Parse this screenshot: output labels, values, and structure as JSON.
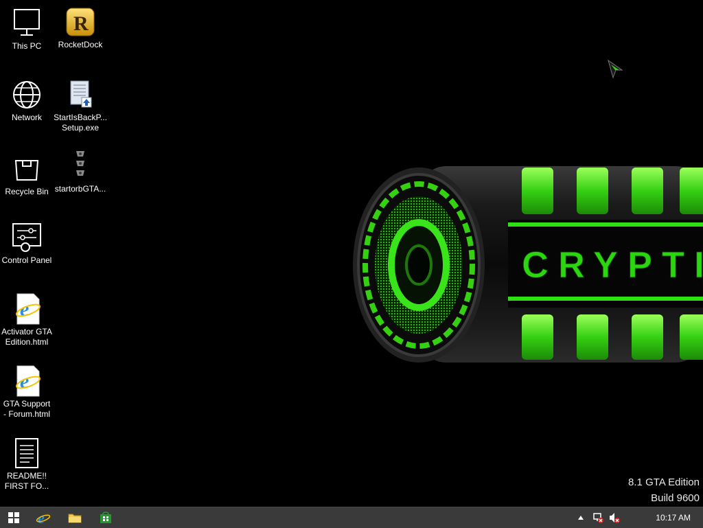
{
  "desktop": {
    "icons": [
      {
        "label": "This PC",
        "icon": "this-pc-icon"
      },
      {
        "label": "RocketDock",
        "icon": "rocketdock-icon"
      },
      {
        "label": "Network",
        "icon": "network-icon"
      },
      {
        "label": "StartIsBackP...\nSetup.exe",
        "icon": "installer-icon"
      },
      {
        "label": "Recycle Bin",
        "icon": "recycle-bin-icon"
      },
      {
        "label": "startorbGTA...",
        "icon": "start-orb-icon"
      },
      {
        "label": "Control Panel",
        "icon": "control-panel-icon"
      },
      {
        "label": "Activator GTA\nEdition.html",
        "icon": "ie-document-icon"
      },
      {
        "label": "GTA Support\n- Forum.html",
        "icon": "ie-document-icon"
      },
      {
        "label": "README!!\nFIRST FO...",
        "icon": "text-document-icon"
      }
    ]
  },
  "wallpaper": {
    "brand": "CRYPTIC",
    "accent_color": "#39e51a"
  },
  "watermark": {
    "edition": "8.1 GTA Edition",
    "build": "Build 9600"
  },
  "taskbar": {
    "buttons": [
      {
        "name": "start",
        "icon": "windows-start-icon"
      },
      {
        "name": "internet-explorer",
        "icon": "internet-explorer-icon"
      },
      {
        "name": "file-explorer",
        "icon": "folder-icon"
      },
      {
        "name": "store",
        "icon": "store-icon"
      }
    ],
    "tray": [
      "show-hidden-icons",
      "network-disconnected-icon",
      "volume-muted-icon"
    ],
    "clock": "10:17 AM"
  }
}
